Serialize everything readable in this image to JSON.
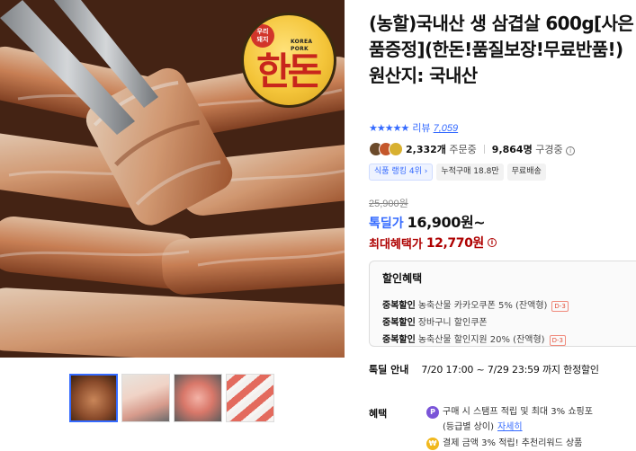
{
  "logo": {
    "badge": "우리\n돼지",
    "subtitle": "KOREA\nPORK",
    "main": "한돈"
  },
  "product": {
    "title": "(농할)국내산 생 삼겹살 600g[사은품증정](한돈!품질보장!무료반품!) 원산지: 국내산",
    "stars": "★★★★★",
    "review_label": "리뷰",
    "review_count": "7,059",
    "order_count": "2,332개",
    "order_suffix": "주문중",
    "subscriber_count": "9,864명",
    "subscriber_suffix": "구경중",
    "badges": [
      "식품 랭킹 4위",
      "누적구매 18.8만",
      "무료배송"
    ],
    "original_price": "25,900원",
    "deal_label": "톡딜가",
    "deal_price": "16,900원~",
    "max_label": "최대혜택가",
    "max_price": "12,770원"
  },
  "discount": {
    "title": "할인혜택",
    "items": [
      {
        "label": "중복할인",
        "text": "농축산물 카카오쿠폰 5% (잔액형)",
        "tag": "D-3"
      },
      {
        "label": "중복할인",
        "text": "장바구니 할인쿠폰",
        "tag": ""
      },
      {
        "label": "중복할인",
        "text": "농축산물 할인지원 20% (잔액형)",
        "tag": "D-3"
      }
    ]
  },
  "deal_period": {
    "label": "톡딜 안내",
    "value": "7/20 17:00 ~ 7/29 23:59 까지 한정할인"
  },
  "benefit": {
    "label": "혜택",
    "line1": "구매 시 스탬프 적립 및 최대 3% 쇼핑포",
    "line2": "(등급별 상이)",
    "line2_link": "자세히",
    "line3": "결제 금액 3% 적립! 추천리워드 상품 ",
    "coin1": "P",
    "coin2": "₩"
  },
  "colors": {
    "accent": "#346aff",
    "max_price": "#ae0000",
    "logo_gold": "#f4c53a"
  }
}
